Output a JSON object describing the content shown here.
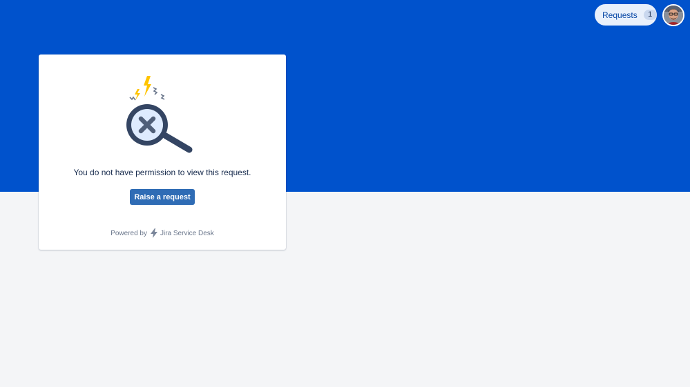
{
  "header": {
    "requests_label": "Requests",
    "requests_count": "1"
  },
  "card": {
    "message": "You do not have permission to view this request.",
    "raise_button_label": "Raise a request",
    "powered_by_prefix": "Powered by",
    "powered_by_product": "Jira Service Desk"
  },
  "icons": {
    "illustration": "magnifier-x-icon",
    "jira_logo": "jira-bolt-icon",
    "avatar": "user-avatar"
  },
  "colors": {
    "hero_background": "#0052cc",
    "page_background": "#f4f5f7",
    "button_primary": "#2f6cb5",
    "text_primary": "#172b4d",
    "text_muted": "#6b778c"
  }
}
